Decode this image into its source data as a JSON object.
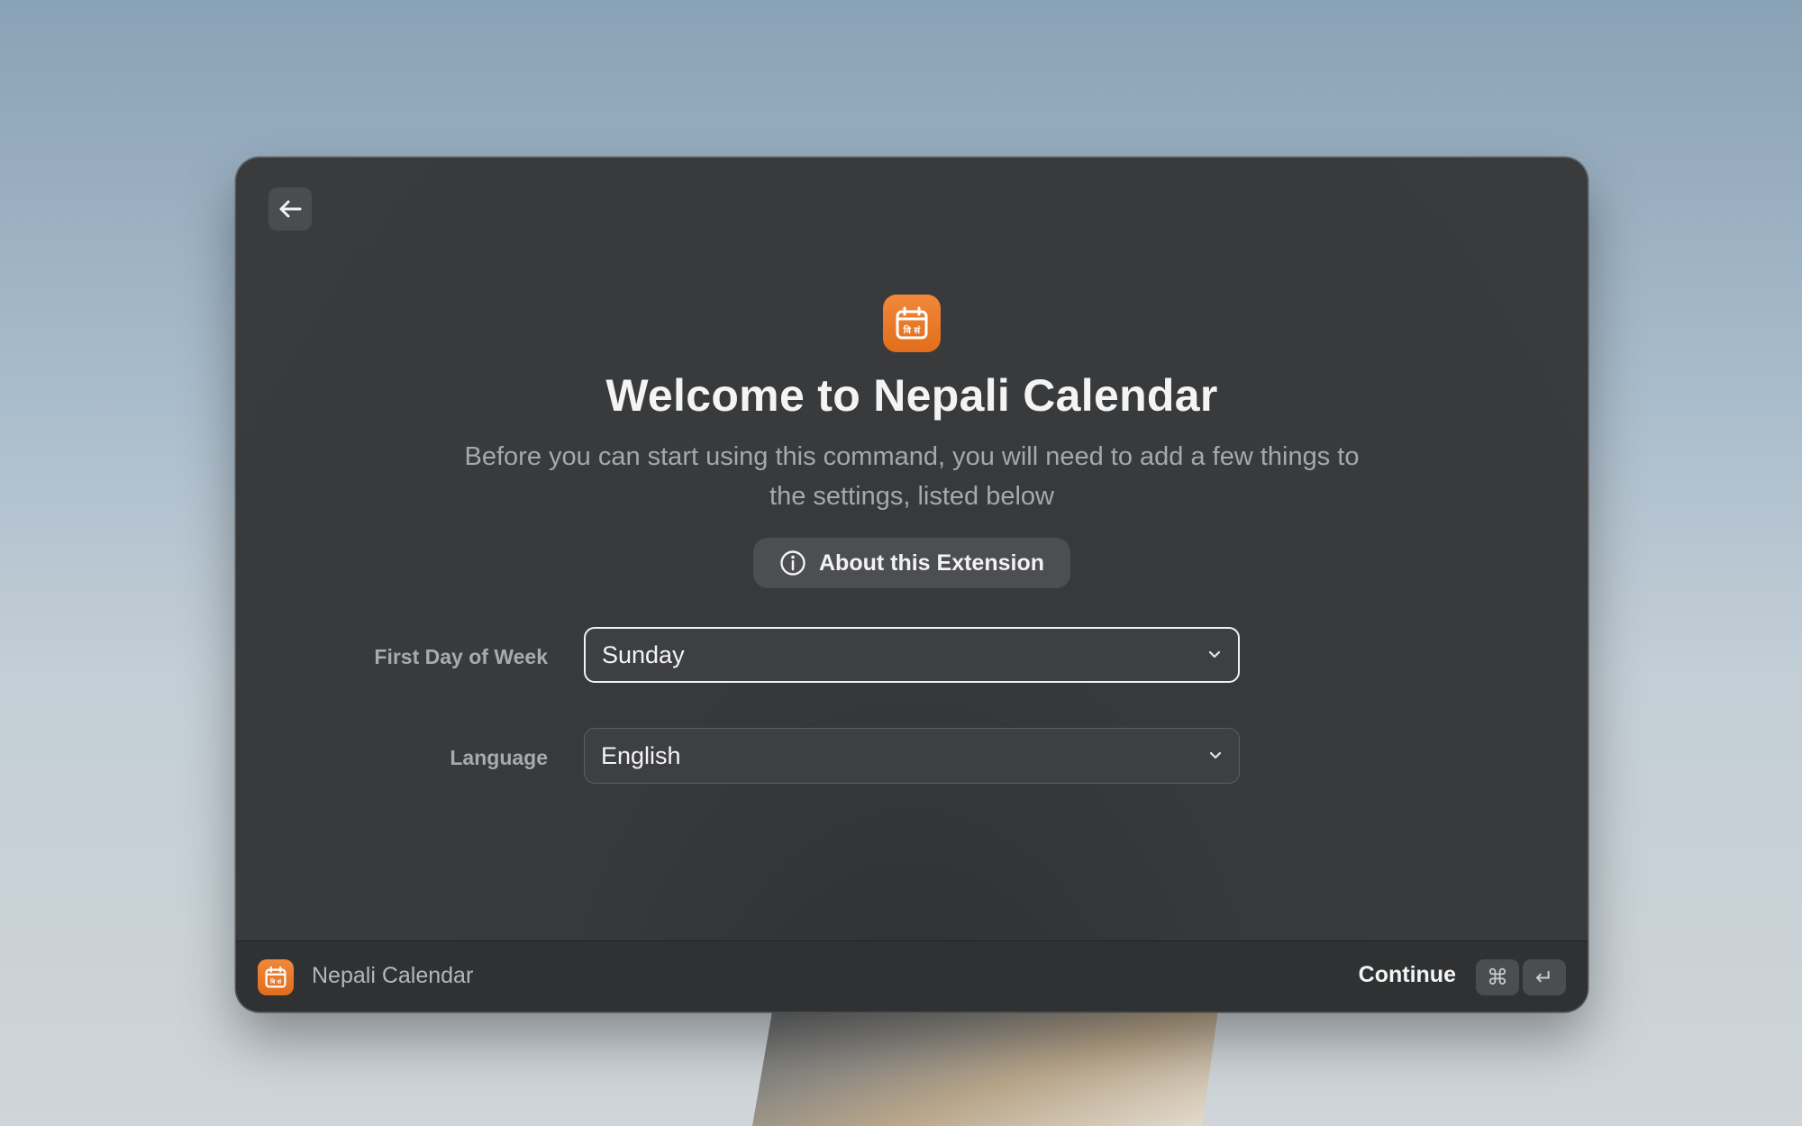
{
  "onboarding": {
    "title": "Welcome to Nepali Calendar",
    "subtitle": "Before you can start using this command, you will need to add a few things to the settings, listed below",
    "about_button_label": "About this Extension"
  },
  "fields": {
    "first_day": {
      "label": "First Day of Week",
      "value": "Sunday"
    },
    "language": {
      "label": "Language",
      "value": "English"
    }
  },
  "footer": {
    "extension_name": "Nepali Calendar",
    "action_label": "Continue",
    "shortcut_keys": [
      "⌘",
      "↵"
    ]
  },
  "icon_text": "वि सं",
  "colors": {
    "accent": "#e9792a",
    "window_bg": "#393b3d"
  }
}
